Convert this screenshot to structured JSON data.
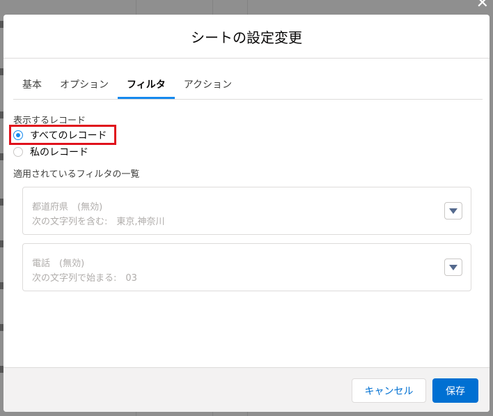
{
  "modal": {
    "title": "シートの設定変更"
  },
  "tabs": [
    {
      "label": "基本",
      "active": false
    },
    {
      "label": "オプション",
      "active": false
    },
    {
      "label": "フィルタ",
      "active": true
    },
    {
      "label": "アクション",
      "active": false
    }
  ],
  "records": {
    "label": "表示するレコード",
    "options": [
      {
        "label": "すべてのレコード",
        "checked": true
      },
      {
        "label": "私のレコード",
        "checked": false
      }
    ]
  },
  "filters": {
    "label": "適用されているフィルタの一覧",
    "items": [
      {
        "title": "都道府県　(無効)",
        "condition": "次の文字列を含む:　東京,神奈川"
      },
      {
        "title": "電話　(無効)",
        "condition": "次の文字列で始まる:　03"
      }
    ]
  },
  "footer": {
    "cancel_label": "キャンセル",
    "save_label": "保存"
  },
  "colors": {
    "accent": "#1589ee",
    "brand": "#0070d2",
    "highlight": "#e0111c"
  },
  "icons": {
    "close": "close-icon",
    "dropdown": "triangle-down-icon"
  }
}
